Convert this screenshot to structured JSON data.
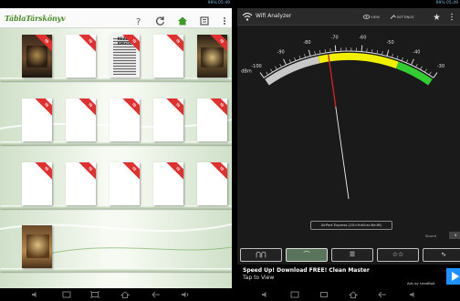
{
  "left_app": {
    "logo": "TáblaTárskönyv",
    "books": [
      {
        "cover": "cover1",
        "badge": "ÚJ",
        "title": ""
      },
      {
        "cover": "blank",
        "badge": "ÚJ",
        "title": ""
      },
      {
        "cover": "cover2",
        "badge": "ÚJ",
        "title": "KEZDŐ ANGOL"
      },
      {
        "cover": "blank",
        "badge": "ÚJ",
        "title": ""
      },
      {
        "cover": "cover3",
        "badge": "ÚJ",
        "title": ""
      },
      {
        "cover": "blank",
        "badge": "ÚJ",
        "title": ""
      },
      {
        "cover": "blank",
        "badge": "ÚJ",
        "title": ""
      },
      {
        "cover": "blank",
        "badge": "ÚJ",
        "title": ""
      },
      {
        "cover": "blank",
        "badge": "ÚJ",
        "title": ""
      },
      {
        "cover": "blank",
        "badge": "ÚJ",
        "title": ""
      },
      {
        "cover": "blank",
        "badge": "ÚJ",
        "title": ""
      },
      {
        "cover": "blank",
        "badge": "ÚJ",
        "title": ""
      },
      {
        "cover": "blank",
        "badge": "ÚJ",
        "title": ""
      },
      {
        "cover": "blank",
        "badge": "ÚJ",
        "title": ""
      },
      {
        "cover": "blank",
        "badge": "ÚJ",
        "title": ""
      },
      {
        "cover": "cover4",
        "badge": "",
        "title": ""
      }
    ],
    "status": "99% 05:49"
  },
  "right_app": {
    "title": "Wifi Analyzer",
    "view_label": "VIEW",
    "settings_label": "SETTINGS",
    "status": "99% 05:49",
    "scale_labels": [
      "-100",
      "-90",
      "-80",
      "-70",
      "-60",
      "-50",
      "-40",
      "-30"
    ],
    "dbm_label": "dBm",
    "needle_value_dbm": -73,
    "ap_name": "AirPort Express (20:c9:d0:ac:8e:f6)",
    "sound_label": "Sound",
    "sound_value": "N",
    "tabs": [
      {
        "label": "Channel graph",
        "glyph": "⋂⋂"
      },
      {
        "label": "Signal meter",
        "glyph": "⌒"
      },
      {
        "label": "AP list",
        "glyph": "☰"
      },
      {
        "label": "Channel rating",
        "glyph": "☆☆"
      },
      {
        "label": "Time graph",
        "glyph": "∿"
      }
    ],
    "active_tab": 1,
    "ad": {
      "title": "Speed Up! Download FREE! Clean Master",
      "subtitle": "Tap to View",
      "by": "Ads by LeadBolt"
    },
    "zone_colors": {
      "grey": "#c8c8c8",
      "yellow": "#f0f000",
      "green": "#33cc33",
      "needle": "#cc2222"
    }
  }
}
